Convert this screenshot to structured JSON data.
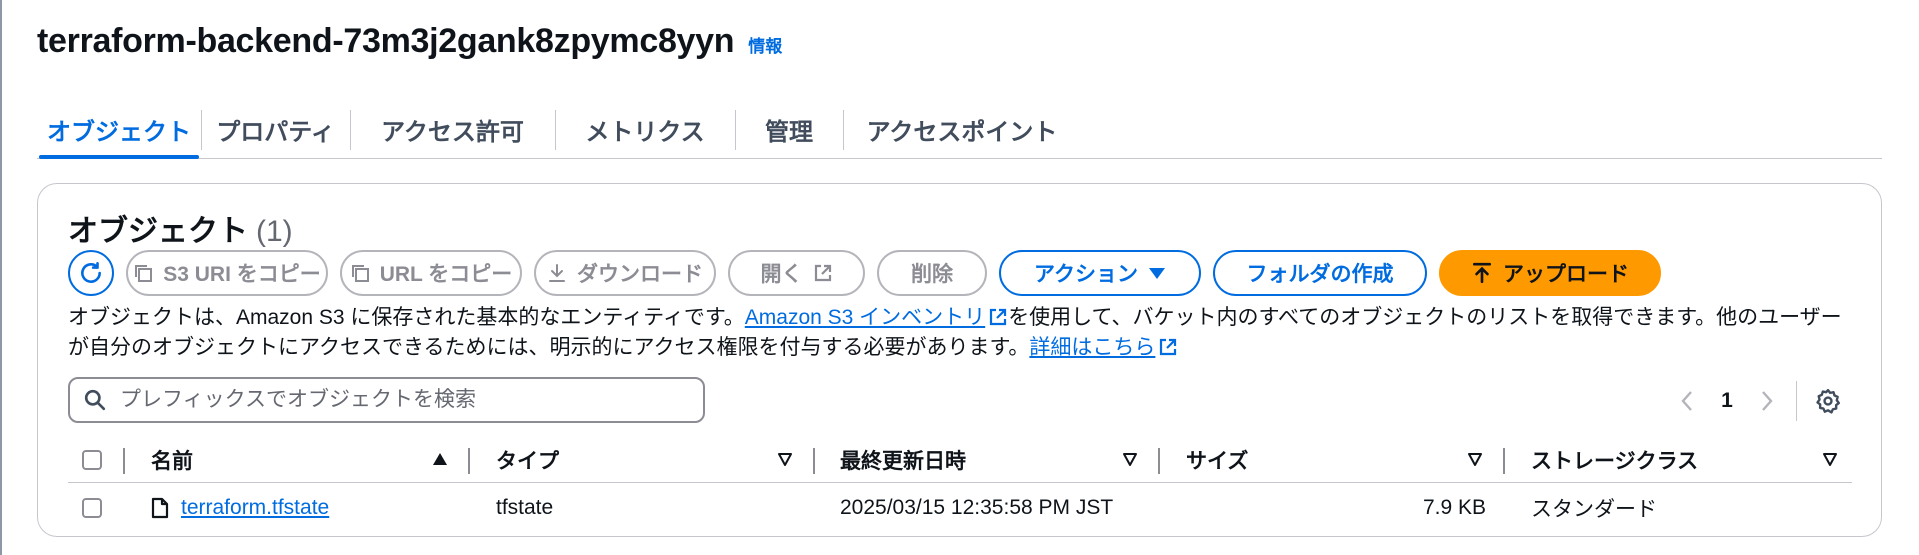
{
  "header": {
    "bucket_name": "terraform-backend-73m3j2gank8zpymc8yyn",
    "info_link": "情報"
  },
  "tabs": [
    {
      "label": "オブジェクト",
      "active": true
    },
    {
      "label": "プロパティ"
    },
    {
      "label": "アクセス許可"
    },
    {
      "label": "メトリクス"
    },
    {
      "label": "管理"
    },
    {
      "label": "アクセスポイント"
    }
  ],
  "objects": {
    "title": "オブジェクト",
    "count": "(1)",
    "toolbar": {
      "copy_s3_uri": "S3 URI をコピー",
      "copy_url": "URL をコピー",
      "download": "ダウンロード",
      "open": "開く",
      "delete": "削除",
      "actions": "アクション",
      "create_folder": "フォルダの作成",
      "upload": "アップロード"
    },
    "description": {
      "part1": "オブジェクトは、Amazon S3 に保存された基本的なエンティティです。",
      "inventory_link": "Amazon S3 インベントリ",
      "part2": "を使用して、バケット内のすべてのオブジェクトのリストを取得できます。他のユーザーが自分のオブジェクトにアクセスできるためには、明示的にアクセス権限を付与する必要があります。",
      "learn_more_link": "詳細はこちら"
    },
    "search": {
      "placeholder": "プレフィックスでオブジェクトを検索",
      "value": ""
    },
    "pagination": {
      "current_page": "1"
    },
    "columns": {
      "name": "名前",
      "type": "タイプ",
      "last_modified": "最終更新日時",
      "size": "サイズ",
      "storage_class": "ストレージクラス"
    },
    "rows": [
      {
        "name": "terraform.tfstate",
        "type": "tfstate",
        "last_modified": "2025/03/15 12:35:58 PM JST",
        "size": "7.9 KB",
        "storage_class": "スタンダード"
      }
    ]
  },
  "colors": {
    "link_blue": "#006ce0",
    "upload_orange": "#ff9900",
    "border_gray": "#8c8c94",
    "text_dark": "#0f141a"
  },
  "icons": [
    "refresh-icon",
    "copy-icon",
    "download-icon",
    "external-link-icon",
    "caret-down-icon",
    "upload-icon",
    "search-icon",
    "chevron-left-icon",
    "chevron-right-icon",
    "gear-icon",
    "sort-ascending-icon",
    "sort-icon",
    "file-icon"
  ]
}
